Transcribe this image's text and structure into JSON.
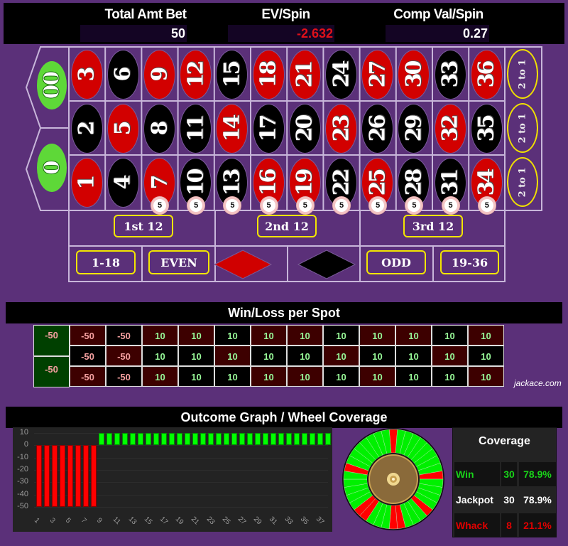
{
  "stats": {
    "total_amt_bet": {
      "label": "Total Amt Bet",
      "value": "50"
    },
    "ev_spin": {
      "label": "EV/Spin",
      "value": "-2.632"
    },
    "comp_val_spin": {
      "label": "Comp Val/Spin",
      "value": "0.27"
    }
  },
  "table": {
    "zeros": [
      "00",
      "0"
    ],
    "rows": [
      [
        {
          "n": "3",
          "c": "red"
        },
        {
          "n": "6",
          "c": "black"
        },
        {
          "n": "9",
          "c": "red"
        },
        {
          "n": "12",
          "c": "red"
        },
        {
          "n": "15",
          "c": "black"
        },
        {
          "n": "18",
          "c": "red"
        },
        {
          "n": "21",
          "c": "red"
        },
        {
          "n": "24",
          "c": "black"
        },
        {
          "n": "27",
          "c": "red"
        },
        {
          "n": "30",
          "c": "red"
        },
        {
          "n": "33",
          "c": "black"
        },
        {
          "n": "36",
          "c": "red"
        }
      ],
      [
        {
          "n": "2",
          "c": "black"
        },
        {
          "n": "5",
          "c": "red"
        },
        {
          "n": "8",
          "c": "black"
        },
        {
          "n": "11",
          "c": "black"
        },
        {
          "n": "14",
          "c": "red"
        },
        {
          "n": "17",
          "c": "black"
        },
        {
          "n": "20",
          "c": "black"
        },
        {
          "n": "23",
          "c": "red"
        },
        {
          "n": "26",
          "c": "black"
        },
        {
          "n": "29",
          "c": "black"
        },
        {
          "n": "32",
          "c": "red"
        },
        {
          "n": "35",
          "c": "black"
        }
      ],
      [
        {
          "n": "1",
          "c": "red"
        },
        {
          "n": "4",
          "c": "black"
        },
        {
          "n": "7",
          "c": "red"
        },
        {
          "n": "10",
          "c": "black"
        },
        {
          "n": "13",
          "c": "black"
        },
        {
          "n": "16",
          "c": "red"
        },
        {
          "n": "19",
          "c": "red"
        },
        {
          "n": "22",
          "c": "black"
        },
        {
          "n": "25",
          "c": "red"
        },
        {
          "n": "28",
          "c": "black"
        },
        {
          "n": "31",
          "c": "black"
        },
        {
          "n": "34",
          "c": "red"
        }
      ]
    ],
    "column_bets": [
      "2 to 1",
      "2 to 1",
      "2 to 1"
    ],
    "chips": {
      "value": "5",
      "count": 10
    },
    "dozens": [
      "1st 12",
      "2nd 12",
      "3rd 12"
    ],
    "outside": [
      "1-18",
      "EVEN",
      "red",
      "black",
      "ODD",
      "19-36"
    ]
  },
  "win_loss": {
    "title": "Win/Loss per Spot",
    "zeros": [
      "-50",
      "-50"
    ],
    "rows": [
      [
        "-50",
        "-50",
        "10",
        "10",
        "10",
        "10",
        "10",
        "10",
        "10",
        "10",
        "10",
        "10"
      ],
      [
        "-50",
        "-50",
        "10",
        "10",
        "10",
        "10",
        "10",
        "10",
        "10",
        "10",
        "10",
        "10"
      ],
      [
        "-50",
        "-50",
        "10",
        "10",
        "10",
        "10",
        "10",
        "10",
        "10",
        "10",
        "10",
        "10"
      ]
    ],
    "watermark": "jackace.com"
  },
  "outcome": {
    "title": "Outcome Graph / Wheel Coverage"
  },
  "chart_data": {
    "type": "bar",
    "title": "Outcome Graph",
    "xlabel": "",
    "ylabel": "",
    "ylim": [
      -50,
      10
    ],
    "yticks": [
      "10",
      "0",
      "-10",
      "-20",
      "-30",
      "-40",
      "-50"
    ],
    "xticks": [
      "1",
      "3",
      "5",
      "7",
      "9",
      "11",
      "13",
      "15",
      "17",
      "19",
      "21",
      "23",
      "25",
      "27",
      "29",
      "31",
      "33",
      "35",
      "37"
    ],
    "categories": [
      "1",
      "2",
      "3",
      "4",
      "5",
      "6",
      "7",
      "8",
      "9",
      "10",
      "11",
      "12",
      "13",
      "14",
      "15",
      "16",
      "17",
      "18",
      "19",
      "20",
      "21",
      "22",
      "23",
      "24",
      "25",
      "26",
      "27",
      "28",
      "29",
      "30",
      "31",
      "32",
      "33",
      "34",
      "35",
      "36",
      "37",
      "38"
    ],
    "values": [
      -50,
      -50,
      -50,
      -50,
      -50,
      -50,
      -50,
      -50,
      10,
      10,
      10,
      10,
      10,
      10,
      10,
      10,
      10,
      10,
      10,
      10,
      10,
      10,
      10,
      10,
      10,
      10,
      10,
      10,
      10,
      10,
      10,
      10,
      10,
      10,
      10,
      10,
      10,
      10
    ],
    "colors": {
      "win": "#00ff00",
      "lose": "#ff0000"
    }
  },
  "coverage": {
    "title": "Coverage",
    "rows": [
      {
        "label": "Win",
        "count": "30",
        "pct": "78.9%",
        "tone": "green"
      },
      {
        "label": "Jackpot",
        "count": "30",
        "pct": "78.9%",
        "tone": "white"
      },
      {
        "label": "Whack",
        "count": "8",
        "pct": "21.1%",
        "tone": "red"
      }
    ]
  }
}
